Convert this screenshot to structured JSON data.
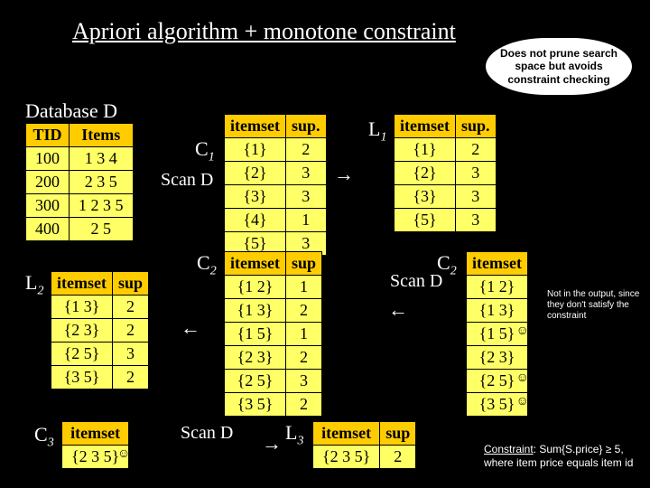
{
  "title": "Apriori algorithm + monotone constraint",
  "callout": "Does not prune search space but avoids constraint checking",
  "note": "Not in the output, since they don't satisfy the constraint",
  "constraint_label": "Constraint",
  "constraint_text": ": Sum{S.price} ≥ 5, where item price equals item id",
  "database_label": "Database D",
  "labels": {
    "C1": "C",
    "C1sub": "1",
    "L1": "L",
    "L1sub": "1",
    "C2": "C",
    "C2sub": "2",
    "L2": "L",
    "L2sub": "2",
    "C2b": "C",
    "C2bsub": "2",
    "C3": "C",
    "C3sub": "3",
    "L3": "L",
    "L3sub": "3",
    "scanD": "Scan D"
  },
  "db": {
    "headers": [
      "TID",
      "Items"
    ],
    "rows": [
      [
        "100",
        "1 3 4"
      ],
      [
        "200",
        "2 3 5"
      ],
      [
        "300",
        "1 2 3 5"
      ],
      [
        "400",
        "2 5"
      ]
    ]
  },
  "C1": {
    "headers": [
      "itemset",
      "sup."
    ],
    "rows": [
      [
        "{1}",
        "2"
      ],
      [
        "{2}",
        "3"
      ],
      [
        "{3}",
        "3"
      ],
      [
        "{4}",
        "1"
      ],
      [
        "{5}",
        "3"
      ]
    ]
  },
  "L1": {
    "headers": [
      "itemset",
      "sup."
    ],
    "rows": [
      [
        "{1}",
        "2"
      ],
      [
        "{2}",
        "3"
      ],
      [
        "{3}",
        "3"
      ],
      [
        "{5}",
        "3"
      ]
    ]
  },
  "C2a": {
    "headers": [
      "itemset"
    ],
    "rows": [
      [
        "{1 2}"
      ],
      [
        "{1 3}"
      ],
      [
        "{1 5}"
      ],
      [
        "{2 3}"
      ],
      [
        "{2 5}"
      ],
      [
        "{3 5}"
      ]
    ],
    "marks": [
      false,
      false,
      true,
      false,
      true,
      true
    ]
  },
  "C2b": {
    "headers": [
      "itemset",
      "sup"
    ],
    "rows": [
      [
        "{1 2}",
        "1"
      ],
      [
        "{1 3}",
        "2"
      ],
      [
        "{1 5}",
        "1"
      ],
      [
        "{2 3}",
        "2"
      ],
      [
        "{2 5}",
        "3"
      ],
      [
        "{3 5}",
        "2"
      ]
    ]
  },
  "L2": {
    "headers": [
      "itemset",
      "sup"
    ],
    "rows": [
      [
        "{1 3}",
        "2"
      ],
      [
        "{2 3}",
        "2"
      ],
      [
        "{2 5}",
        "3"
      ],
      [
        "{3 5}",
        "2"
      ]
    ]
  },
  "C3": {
    "headers": [
      "itemset"
    ],
    "rows": [
      [
        "{2 3 5}"
      ]
    ],
    "marks": [
      true
    ]
  },
  "L3": {
    "headers": [
      "itemset",
      "sup"
    ],
    "rows": [
      [
        "{2 3 5}",
        "2"
      ]
    ]
  }
}
